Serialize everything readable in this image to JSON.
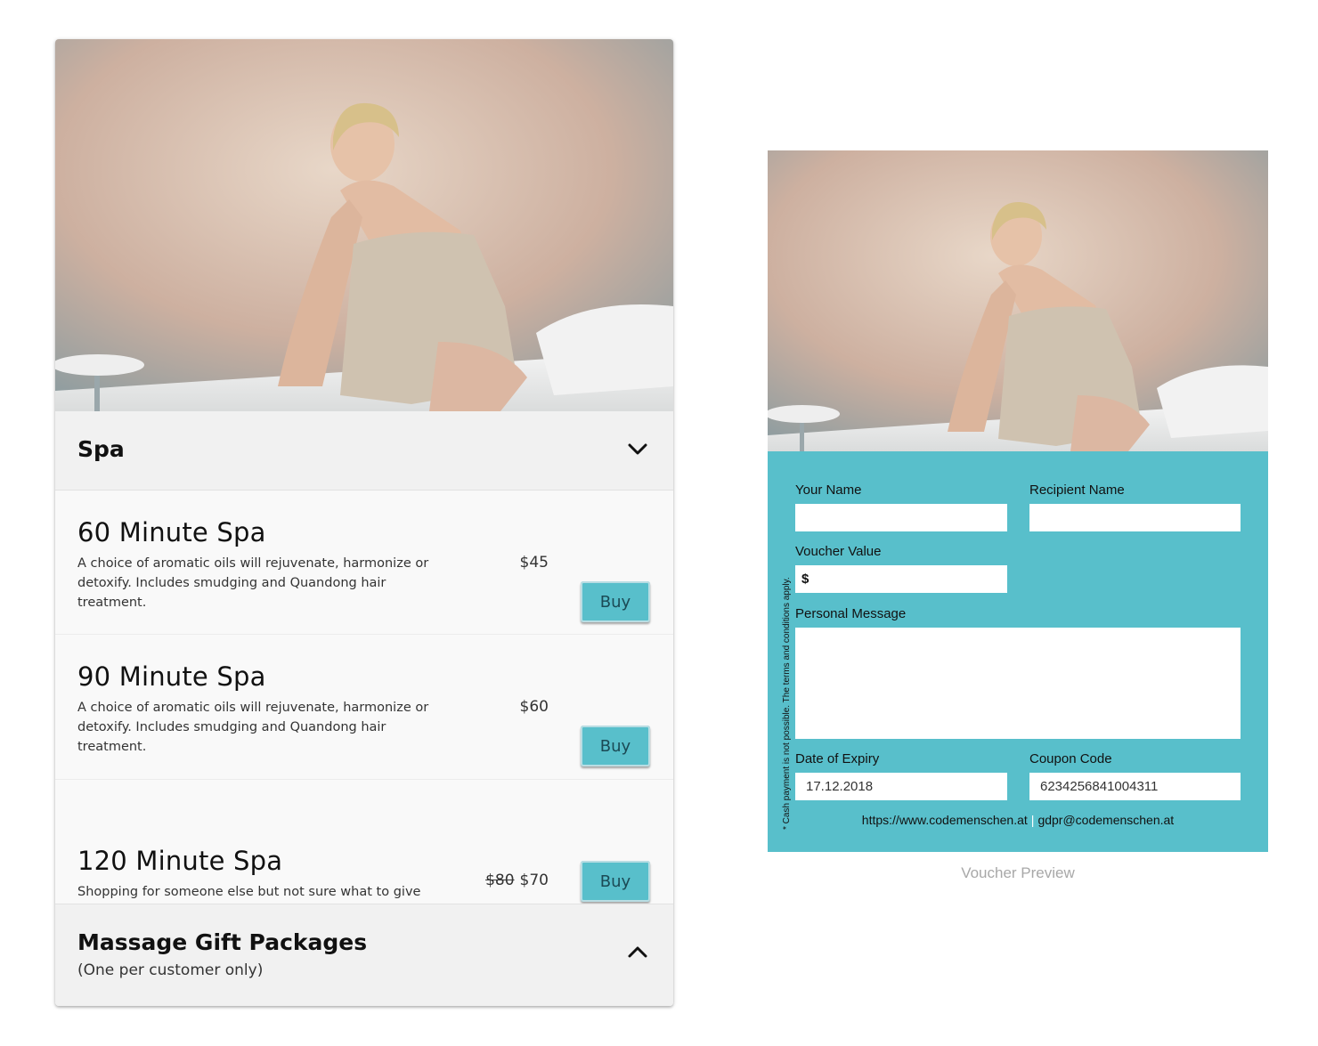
{
  "catalog": {
    "sections": [
      {
        "title": "Spa",
        "subtitle": "",
        "expanded": true,
        "chevron_icon": "chevron-down-icon"
      },
      {
        "title": "Massage Gift Packages",
        "subtitle": "(One per customer only)",
        "expanded": false,
        "chevron_icon": "chevron-up-icon"
      }
    ],
    "items": [
      {
        "title": "60 Minute Spa",
        "description": "A choice of aromatic oils will rejuvenate, harmonize or detoxify. Includes smudging and Quandong hair treatment.",
        "old_price": "",
        "price": "$45",
        "button_label": "Buy"
      },
      {
        "title": "90 Minute Spa",
        "description": "A choice of aromatic oils will rejuvenate, harmonize or detoxify. Includes smudging and Quandong hair treatment.",
        "old_price": "",
        "price": "$60",
        "button_label": "Buy"
      },
      {
        "title": "120 Minute Spa",
        "description": "Shopping for someone else but not sure what to give them? Give them the gift of choice with a Spa gift card.",
        "old_price": "$80",
        "price": "$70",
        "button_label": "Buy"
      }
    ]
  },
  "voucher": {
    "labels": {
      "your_name": "Your Name",
      "recipient_name": "Recipient Name",
      "voucher_value": "Voucher Value",
      "personal_message": "Personal Message",
      "date_of_expiry": "Date of Expiry",
      "coupon_code": "Coupon Code"
    },
    "values": {
      "your_name": "",
      "recipient_name": "",
      "voucher_value": "$",
      "personal_message": "",
      "date_of_expiry": "17.12.2018",
      "coupon_code": "6234256841004311"
    },
    "links": {
      "website": "https://www.codemenschen.at",
      "separator": "|",
      "email": "gdpr@codemenschen.at"
    },
    "side_note": "* Cash payment is not possible. The terms and conditions apply.",
    "caption": "Voucher Preview"
  },
  "colors": {
    "accent": "#58bfcb",
    "card_bg": "#f9f9f9",
    "section_bg": "#f1f1f1",
    "caption": "#a8a8a8"
  }
}
